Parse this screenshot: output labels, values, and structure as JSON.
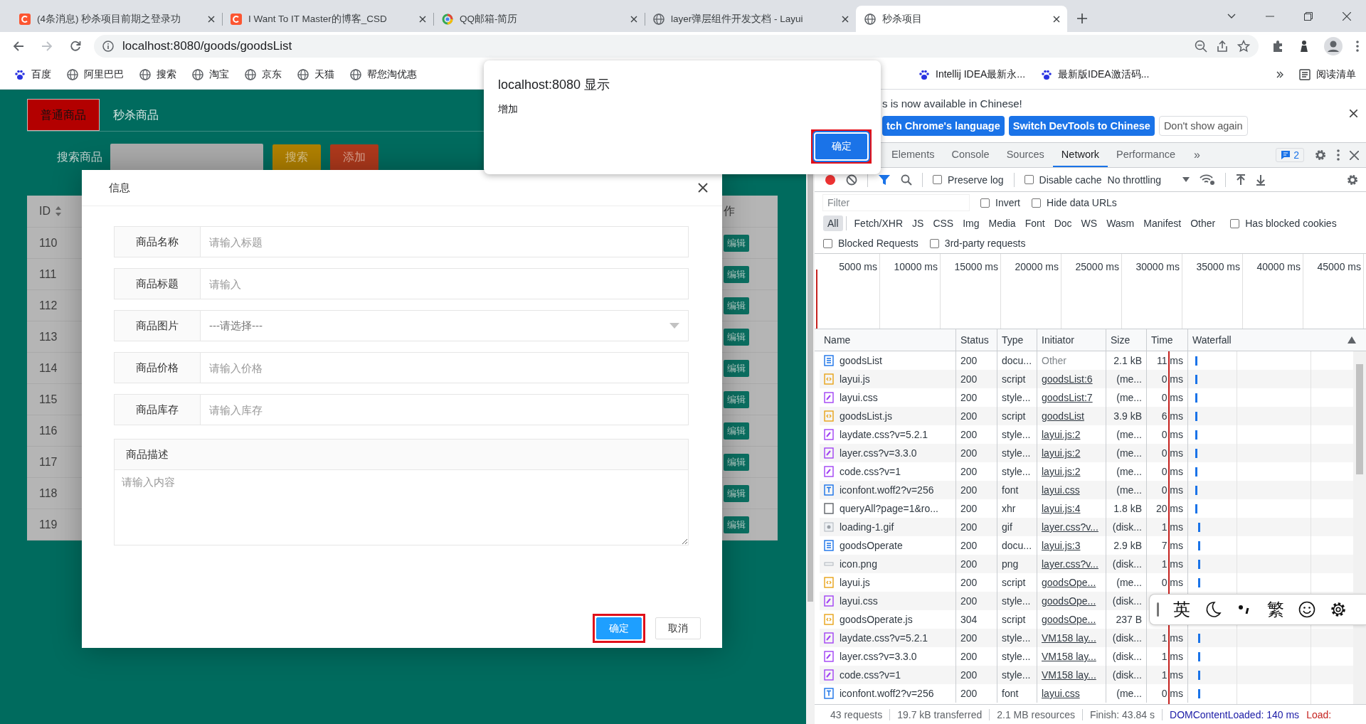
{
  "browser": {
    "tabs": [
      {
        "title": "(4条消息) 秒杀项目前期之登录功",
        "kind": "csdn",
        "selected": false
      },
      {
        "title": "I Want To IT Master的博客_CSD",
        "kind": "csdn",
        "selected": false
      },
      {
        "title": "QQ邮箱-简历",
        "kind": "ring",
        "selected": false
      },
      {
        "title": "layer弹层组件开发文档 - Layui",
        "kind": "globe",
        "selected": false
      },
      {
        "title": "秒杀项目",
        "kind": "globe",
        "selected": true
      }
    ],
    "url": "localhost:8080/goods/goodsList",
    "bookmarks": [
      {
        "label": "百度",
        "kind": "paw"
      },
      {
        "label": "阿里巴巴",
        "kind": "globe"
      },
      {
        "label": "搜索",
        "kind": "globe"
      },
      {
        "label": "淘宝",
        "kind": "globe"
      },
      {
        "label": "京东",
        "kind": "globe"
      },
      {
        "label": "天猫",
        "kind": "globe"
      },
      {
        "label": "帮您淘优惠",
        "kind": "globe"
      }
    ],
    "more_bookmarks": [
      {
        "label": "Intellij IDEA最新永...",
        "kind": "paw"
      },
      {
        "label": "最新版IDEA激活码...",
        "kind": "paw"
      }
    ],
    "reading_list": "阅读清单"
  },
  "page": {
    "nav_tabs": [
      {
        "label": "普通商品",
        "selected": true
      },
      {
        "label": "秒杀商品",
        "selected": false
      }
    ],
    "search_label": "搜索商品",
    "buttons": [
      {
        "label": "搜索",
        "kind": "search"
      },
      {
        "label": "添加",
        "kind": "add"
      }
    ],
    "table": {
      "columns": [
        "ID",
        "作"
      ],
      "rows": [
        {
          "id": "110",
          "action": "编辑"
        },
        {
          "id": "111",
          "action": "编辑"
        },
        {
          "id": "112",
          "action": "编辑"
        },
        {
          "id": "113",
          "action": "编辑"
        },
        {
          "id": "114",
          "action": "编辑"
        },
        {
          "id": "115",
          "action": "编辑"
        },
        {
          "id": "116",
          "action": "编辑"
        },
        {
          "id": "117",
          "action": "编辑"
        },
        {
          "id": "118",
          "action": "编辑"
        },
        {
          "id": "119",
          "action": "编辑"
        }
      ]
    }
  },
  "modal": {
    "title": "信息",
    "fields": [
      {
        "kind": "text",
        "label": "商品名称",
        "placeholder": "请输入标题"
      },
      {
        "kind": "text",
        "label": "商品标题",
        "placeholder": "请输入"
      },
      {
        "kind": "select",
        "label": "商品图片",
        "placeholder": "---请选择---"
      },
      {
        "kind": "text",
        "label": "商品价格",
        "placeholder": "请输入价格"
      },
      {
        "kind": "text",
        "label": "商品库存",
        "placeholder": "请输入库存"
      }
    ],
    "description": {
      "label": "商品描述",
      "placeholder": "请输入内容"
    },
    "buttons": [
      {
        "label": "确定",
        "kind": "primary",
        "highlighted": true
      },
      {
        "label": "取消",
        "kind": "secondary",
        "highlighted": false
      }
    ]
  },
  "alert": {
    "title": "localhost:8080 显示",
    "message": "增加",
    "button": {
      "label": "确定",
      "highlighted": true
    }
  },
  "devtools": {
    "notice": {
      "text": "s is now available in Chinese!",
      "buttons": [
        {
          "label": "tch Chrome's language",
          "kind": "primary"
        },
        {
          "label": "Switch DevTools to Chinese",
          "kind": "primary"
        },
        {
          "label": "Don't show again",
          "kind": "secondary"
        }
      ]
    },
    "tabs": [
      {
        "label": "Elements",
        "selected": false
      },
      {
        "label": "Console",
        "selected": false
      },
      {
        "label": "Sources",
        "selected": false
      },
      {
        "label": "Network",
        "selected": true
      },
      {
        "label": "Performance",
        "selected": false
      }
    ],
    "more_tabs": "»",
    "issues_badge": "2",
    "toolbar_options": [
      {
        "label": "Preserve log",
        "checked": false
      },
      {
        "label": "Disable cache",
        "checked": false
      }
    ],
    "throttling": "No throttling",
    "filter": {
      "placeholder": "Filter"
    },
    "filter_options": [
      {
        "label": "Invert",
        "checked": false
      },
      {
        "label": "Hide data URLs",
        "checked": false
      }
    ],
    "types": [
      {
        "label": "All",
        "selected": true
      },
      {
        "label": "Fetch/XHR",
        "selected": false
      },
      {
        "label": "JS",
        "selected": false
      },
      {
        "label": "CSS",
        "selected": false
      },
      {
        "label": "Img",
        "selected": false
      },
      {
        "label": "Media",
        "selected": false
      },
      {
        "label": "Font",
        "selected": false
      },
      {
        "label": "Doc",
        "selected": false
      },
      {
        "label": "WS",
        "selected": false
      },
      {
        "label": "Wasm",
        "selected": false
      },
      {
        "label": "Manifest",
        "selected": false
      },
      {
        "label": "Other",
        "selected": false
      }
    ],
    "type_options": [
      {
        "label": "Has blocked cookies",
        "checked": false
      }
    ],
    "extra_options": [
      {
        "label": "Blocked Requests",
        "checked": false
      },
      {
        "label": "3rd-party requests",
        "checked": false
      }
    ],
    "timeline_ticks": [
      "5000 ms",
      "10000 ms",
      "15000 ms",
      "20000 ms",
      "25000 ms",
      "30000 ms",
      "35000 ms",
      "40000 ms",
      "45000 ms"
    ],
    "columns": [
      "Name",
      "Status",
      "Type",
      "Initiator",
      "Size",
      "Time",
      "Waterfall"
    ],
    "requests": [
      {
        "kind": "doc",
        "name": "goodsList",
        "status": "200",
        "type": "docu...",
        "initiator": "Other",
        "initiator_link": false,
        "size": "2.1 kB",
        "time": "11 ms"
      },
      {
        "kind": "script",
        "name": "layui.js",
        "status": "200",
        "type": "script",
        "initiator": "goodsList:6",
        "initiator_link": true,
        "size": "(me...",
        "time": "0 ms"
      },
      {
        "kind": "style",
        "name": "layui.css",
        "status": "200",
        "type": "style...",
        "initiator": "goodsList:7",
        "initiator_link": true,
        "size": "(me...",
        "time": "0 ms"
      },
      {
        "kind": "script",
        "name": "goodsList.js",
        "status": "200",
        "type": "script",
        "initiator": "goodsList",
        "initiator_link": true,
        "size": "3.9 kB",
        "time": "6 ms"
      },
      {
        "kind": "style",
        "name": "laydate.css?v=5.2.1",
        "status": "200",
        "type": "style...",
        "initiator": "layui.js:2",
        "initiator_link": true,
        "size": "(me...",
        "time": "0 ms"
      },
      {
        "kind": "style",
        "name": "layer.css?v=3.3.0",
        "status": "200",
        "type": "style...",
        "initiator": "layui.js:2",
        "initiator_link": true,
        "size": "(me...",
        "time": "0 ms"
      },
      {
        "kind": "style",
        "name": "code.css?v=1",
        "status": "200",
        "type": "style...",
        "initiator": "layui.js:2",
        "initiator_link": true,
        "size": "(me...",
        "time": "0 ms"
      },
      {
        "kind": "font",
        "name": "iconfont.woff2?v=256",
        "status": "200",
        "type": "font",
        "initiator": "layui.css",
        "initiator_link": true,
        "size": "(me...",
        "time": "0 ms"
      },
      {
        "kind": "xhr",
        "name": "queryAll?page=1&ro...",
        "status": "200",
        "type": "xhr",
        "initiator": "layui.js:4",
        "initiator_link": true,
        "size": "1.8 kB",
        "time": "20 ms"
      },
      {
        "kind": "gif",
        "name": "loading-1.gif",
        "status": "200",
        "type": "gif",
        "initiator": "layer.css?v...",
        "initiator_link": true,
        "size": "(disk...",
        "time": "1 ms"
      },
      {
        "kind": "doc",
        "name": "goodsOperate",
        "status": "200",
        "type": "docu...",
        "initiator": "layui.js:3",
        "initiator_link": true,
        "size": "2.9 kB",
        "time": "7 ms"
      },
      {
        "kind": "png",
        "name": "icon.png",
        "status": "200",
        "type": "png",
        "initiator": "layer.css?v...",
        "initiator_link": true,
        "size": "(disk...",
        "time": "1 ms"
      },
      {
        "kind": "script",
        "name": "layui.js",
        "status": "200",
        "type": "script",
        "initiator": "goodsOpe...",
        "initiator_link": true,
        "size": "(me...",
        "time": "0 ms"
      },
      {
        "kind": "style",
        "name": "layui.css",
        "status": "200",
        "type": "style...",
        "initiator": "goodsOpe...",
        "initiator_link": true,
        "size": "(disk..."
      },
      {
        "kind": "script",
        "name": "goodsOperate.js",
        "status": "304",
        "type": "script",
        "initiator": "goodsOpe...",
        "initiator_link": true,
        "size": "237 B"
      },
      {
        "kind": "style",
        "name": "laydate.css?v=5.2.1",
        "status": "200",
        "type": "style...",
        "initiator": "VM158 lay...",
        "initiator_link": true,
        "size": "(disk...",
        "time": "1 ms"
      },
      {
        "kind": "style",
        "name": "layer.css?v=3.3.0",
        "status": "200",
        "type": "style...",
        "initiator": "VM158 lay...",
        "initiator_link": true,
        "size": "(disk...",
        "time": "1 ms"
      },
      {
        "kind": "style",
        "name": "code.css?v=1",
        "status": "200",
        "type": "style...",
        "initiator": "VM158 lay...",
        "initiator_link": true,
        "size": "(disk...",
        "time": "1 ms"
      },
      {
        "kind": "font",
        "name": "iconfont.woff2?v=256",
        "status": "200",
        "type": "font",
        "initiator": "layui.css",
        "initiator_link": true,
        "size": "(me...",
        "time": "0 ms"
      }
    ],
    "summary": [
      {
        "kind": "plain",
        "text": "43 requests"
      },
      {
        "kind": "plain",
        "text": "19.7 kB transferred"
      },
      {
        "kind": "plain",
        "text": "2.1 MB resources"
      },
      {
        "kind": "plain",
        "text": "Finish: 43.84 s"
      },
      {
        "kind": "dom",
        "text": "DOMContentLoaded: 140 ms"
      },
      {
        "kind": "load",
        "text": "Load:"
      }
    ]
  },
  "ime": {
    "items": [
      {
        "kind": "text",
        "label": "英"
      },
      {
        "kind": "moon"
      },
      {
        "kind": "punct"
      },
      {
        "kind": "text",
        "label": "繁"
      },
      {
        "kind": "smiley"
      },
      {
        "kind": "gear"
      }
    ]
  }
}
